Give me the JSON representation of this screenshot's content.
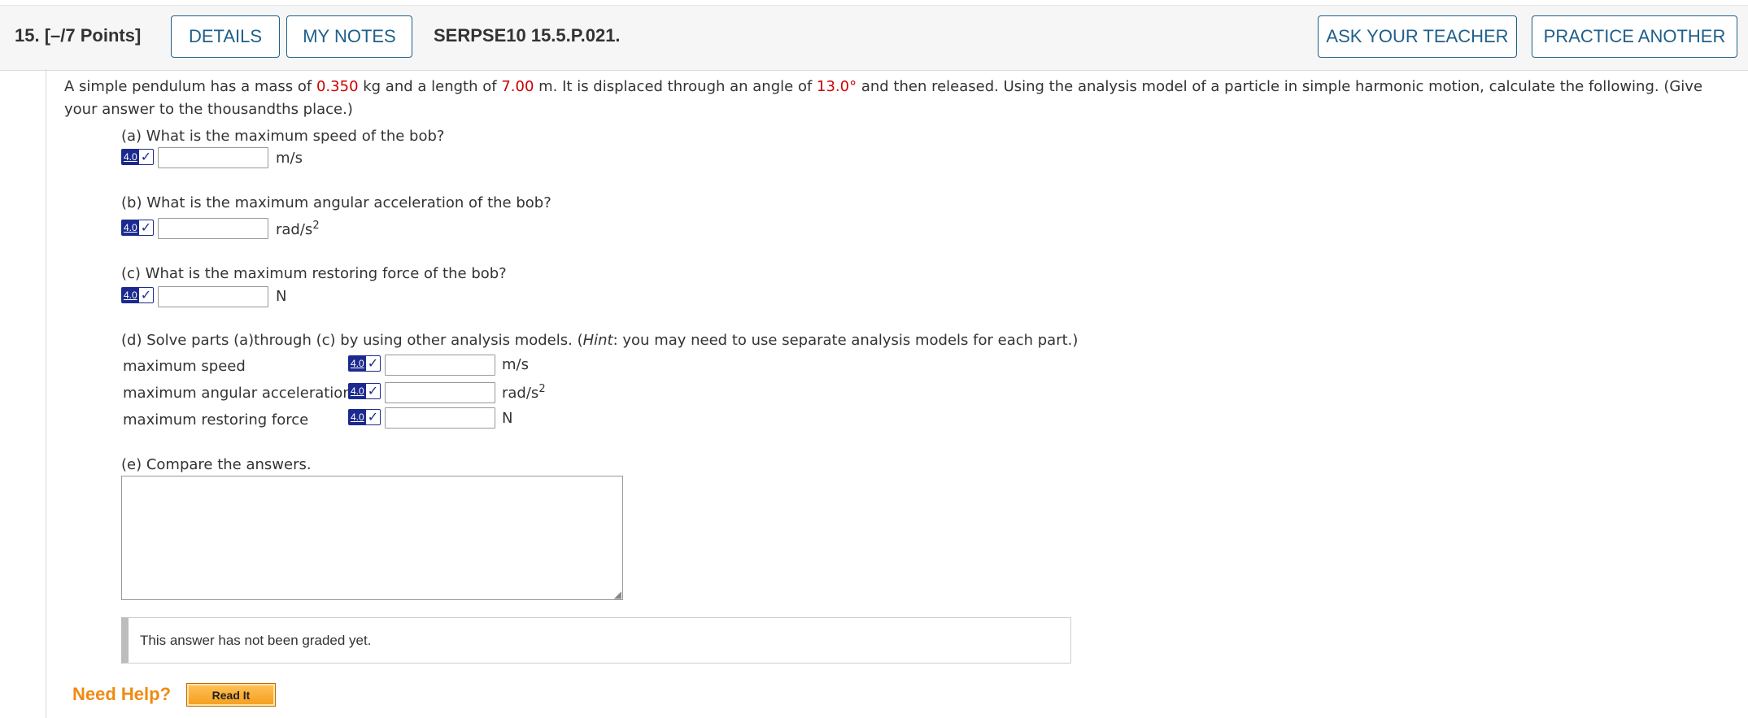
{
  "header": {
    "question_number": "15.",
    "points": "[–/7 Points]",
    "details_label": "DETAILS",
    "my_notes_label": "MY NOTES",
    "question_code": "SERPSE10 15.5.P.021.",
    "ask_teacher_label": "ASK YOUR TEACHER",
    "practice_another_label": "PRACTICE ANOTHER"
  },
  "prompt": {
    "t1": "A simple pendulum has a mass of ",
    "mass": "0.350",
    "t2": " kg and a length of ",
    "length": "7.00",
    "t3": " m. It is displaced through an angle of ",
    "angle": "13.0°",
    "t4": " and then released. Using the analysis model of a particle in simple harmonic motion, calculate the following. (Give your answer to the thousandths place.)"
  },
  "badge_label": "4.0",
  "parts": {
    "a": {
      "question": "(a) What is the maximum speed of the bob?",
      "unit": "m/s",
      "value": ""
    },
    "b": {
      "question": "(b) What is the maximum angular acceleration of the bob?",
      "unit": "rad/s",
      "unit_sup": "2",
      "value": ""
    },
    "c": {
      "question": "(c) What is the maximum restoring force of the bob?",
      "unit": "N",
      "value": ""
    },
    "d": {
      "q1": "(d) Solve parts (a)through (c) by using other analysis models. (",
      "hint": "Hint",
      "q2": ": you may need to use separate analysis models for each part.)",
      "rows": [
        {
          "label": "maximum speed",
          "unit": "m/s",
          "unit_sup": "",
          "value": ""
        },
        {
          "label": "maximum angular acceleration",
          "unit": "rad/s",
          "unit_sup": "2",
          "value": ""
        },
        {
          "label": "maximum restoring force",
          "unit": "N",
          "unit_sup": "",
          "value": ""
        }
      ]
    },
    "e": {
      "question": "(e) Compare the answers.",
      "value": ""
    }
  },
  "graded_text": "This answer has not been graded yet.",
  "need_help_label": "Need Help?",
  "read_it_label": "Read It",
  "colors": {
    "accent_blue": "#1f5f8b",
    "given_value_red": "#cc0000",
    "badge_navy": "#1c2a8f",
    "help_orange": "#f08a12"
  }
}
